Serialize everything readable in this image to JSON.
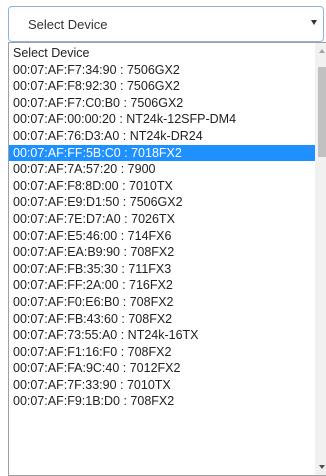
{
  "select": {
    "value": "Select Device",
    "arrow_icon": "triangle-down-icon"
  },
  "dropdown": {
    "selected_index": 6,
    "options": [
      {
        "label": "Select Device"
      },
      {
        "label": "00:07:AF:F7:34:90 : 7506GX2"
      },
      {
        "label": "00:07:AF:F8:92:30 : 7506GX2"
      },
      {
        "label": "00:07:AF:F7:C0:B0 : 7506GX2"
      },
      {
        "label": "00:07:AF:00:00:20 : NT24k-12SFP-DM4"
      },
      {
        "label": "00:07:AF:76:D3:A0 : NT24k-DR24"
      },
      {
        "label": "00:07:AF:FF:5B:C0 : 7018FX2"
      },
      {
        "label": "00:07:AF:7A:57:20 : 7900"
      },
      {
        "label": "00:07:AF:F8:8D:00 : 7010TX"
      },
      {
        "label": "00:07:AF:E9:D1:50 : 7506GX2"
      },
      {
        "label": "00:07:AF:7E:D7:A0 : 7026TX"
      },
      {
        "label": "00:07:AF:E5:46:00 : 714FX6"
      },
      {
        "label": "00:07:AF:EA:B9:90 : 708FX2"
      },
      {
        "label": "00:07:AF:FB:35:30 : 711FX3"
      },
      {
        "label": "00:07:AF:FF:2A:00 : 716FX2"
      },
      {
        "label": "00:07:AF:F0:E6:B0 : 708FX2"
      },
      {
        "label": "00:07:AF:FB:43:60 : 708FX2"
      },
      {
        "label": "00:07:AF:73:55:A0 : NT24k-16TX"
      },
      {
        "label": "00:07:AF:F1:16:F0 : 708FX2"
      },
      {
        "label": "00:07:AF:FA:9C:40 : 7012FX2"
      },
      {
        "label": "00:07:AF:7F:33:90 : 7010TX"
      },
      {
        "label": "00:07:AF:F9:1B:D0 : 708FX2"
      }
    ]
  },
  "scrollbar": {
    "up_icon": "scroll-up-arrow-icon",
    "down_icon": "scroll-down-arrow-icon"
  }
}
